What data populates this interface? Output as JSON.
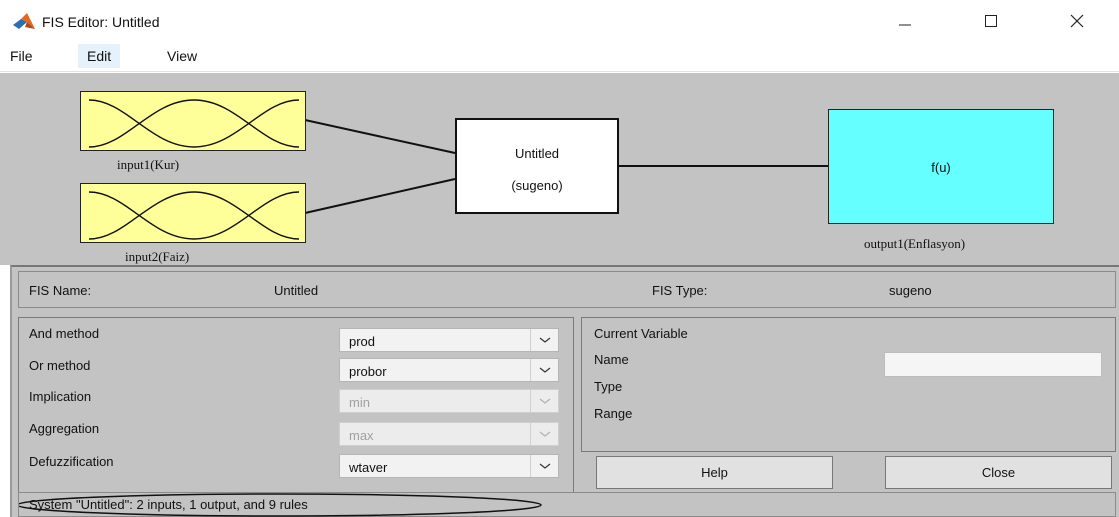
{
  "window": {
    "title": "FIS Editor: Untitled",
    "icon": "matlab-logo-icon",
    "controls": [
      "minimize-icon",
      "maximize-icon",
      "close-icon"
    ]
  },
  "menu": [
    {
      "label": "File"
    },
    {
      "label": "Edit",
      "active": true
    },
    {
      "label": "View"
    }
  ],
  "diagram": {
    "inputs": [
      {
        "label": "input1(Kur)"
      },
      {
        "label": "input2(Faiz)"
      }
    ],
    "system": {
      "name": "Untitled",
      "type_label": "(sugeno)"
    },
    "output": {
      "symbol": "f(u)",
      "label": "output1(Enflasyon)"
    },
    "colors": {
      "input_fill": "#ffff99",
      "output_fill": "#66ffff",
      "system_fill": "#ffffff",
      "panel_bg": "#c3c3c3"
    }
  },
  "fis_info": {
    "name_label": "FIS Name:",
    "name_value": "Untitled",
    "type_label": "FIS Type:",
    "type_value": "sugeno"
  },
  "methods": {
    "and_method": {
      "label": "And method",
      "value": "prod",
      "enabled": true
    },
    "or_method": {
      "label": "Or method",
      "value": "probor",
      "enabled": true
    },
    "implication": {
      "label": "Implication",
      "value": "min",
      "enabled": false
    },
    "aggregation": {
      "label": "Aggregation",
      "value": "max",
      "enabled": false
    },
    "defuzzification": {
      "label": "Defuzzification",
      "value": "wtaver",
      "enabled": true
    }
  },
  "current_variable": {
    "heading": "Current Variable",
    "name_label": "Name",
    "name_value": "",
    "type_label": "Type",
    "range_label": "Range"
  },
  "buttons": {
    "help": "Help",
    "close": "Close"
  },
  "status": {
    "text": "System \"Untitled\": 2 inputs, 1 output, and 9 rules"
  }
}
